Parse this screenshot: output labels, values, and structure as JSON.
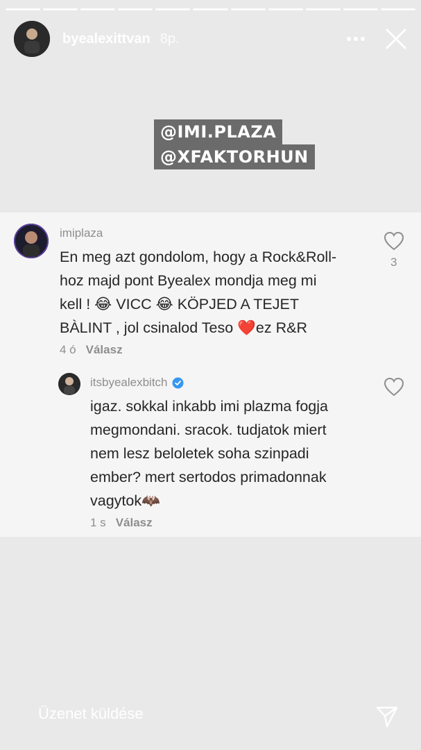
{
  "story": {
    "progress_segments": 11,
    "username": "byealexittvan",
    "time": "8p.",
    "mentions": [
      "@IMI.PLAZA",
      "@XFAKTORHUN"
    ]
  },
  "comment": {
    "username": "imiplaza",
    "text": "En meg azt gondolom, hogy a Rock&Roll-hoz majd pont Byealex mondja meg mi kell ! 😂 VICC 😂 KÖPJED A TEJET BÀLINT , jol csinalod Teso ❤️ez R&R",
    "text_lines": [
      "En meg azt gondolom, hogy a Rock&Roll-",
      "hoz majd pont Byealex mondja meg mi",
      "kell ! 😂 VICC 😂 KÖPJED A TEJET",
      "BÀLINT , jol csinalod Teso ❤️ez R&R"
    ],
    "age": "4 ó",
    "reply_label": "Válasz",
    "like_count": "3"
  },
  "reply": {
    "username": "itsbyealexbitch",
    "verified_icon": "verified-badge-icon",
    "text_lines": [
      "igaz. sokkal inkabb imi plazma fogja",
      "megmondani. sracok. tudjatok miert",
      "nem lesz beloletek soha szinpadi",
      "ember? mert sertodos primadonnak",
      "vagytok🦇"
    ],
    "age": "1 s",
    "reply_label": "Válasz"
  },
  "footer": {
    "message_placeholder": "Üzenet küldése",
    "send_icon": "paper-plane-icon"
  },
  "colors": {
    "background": "#e9e9e9",
    "card": "#f5f5f5",
    "verified": "#3897f0",
    "muted": "#8e8e8e"
  }
}
